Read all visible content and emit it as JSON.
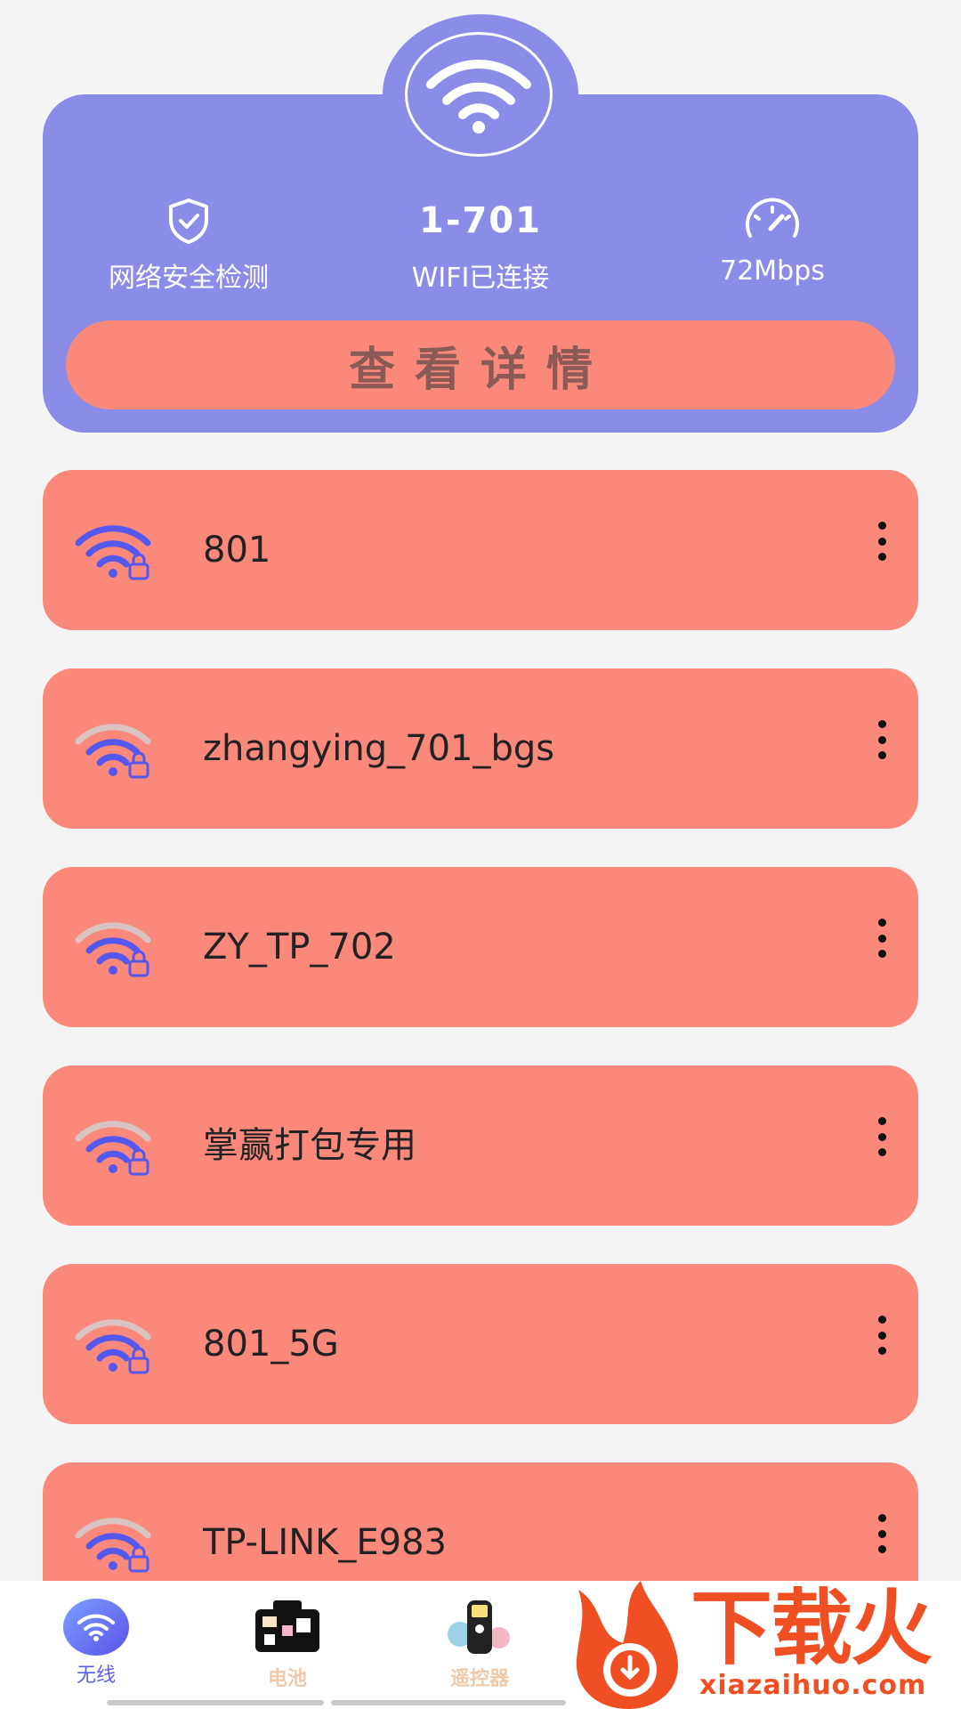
{
  "header": {
    "security_label": "网络安全检测",
    "ssid": "1-701",
    "status": "WIFI已连接",
    "speed": "72Mbps",
    "details_button": "查看详情",
    "colors": {
      "card": "#8b8ce7",
      "button": "#fa897b"
    }
  },
  "networks": [
    {
      "name": "801",
      "signal": "full",
      "locked": true
    },
    {
      "name": "zhangying_701_bgs",
      "signal": "partial",
      "locked": true
    },
    {
      "name": "ZY_TP_702",
      "signal": "partial",
      "locked": true
    },
    {
      "name": "掌赢打包专用",
      "signal": "partial",
      "locked": true
    },
    {
      "name": "801_5G",
      "signal": "partial",
      "locked": true
    },
    {
      "name": "TP-LINK_E983",
      "signal": "partial",
      "locked": true
    }
  ],
  "tabbar": {
    "tabs": [
      {
        "label": "无线",
        "icon": "wifi-icon",
        "active": true
      },
      {
        "label": "电池",
        "icon": "battery-icon",
        "active": false
      },
      {
        "label": "遥控器",
        "icon": "remote-icon",
        "active": false
      }
    ]
  },
  "watermark": {
    "title": "下载火",
    "url": "xiazaihuo.com"
  }
}
